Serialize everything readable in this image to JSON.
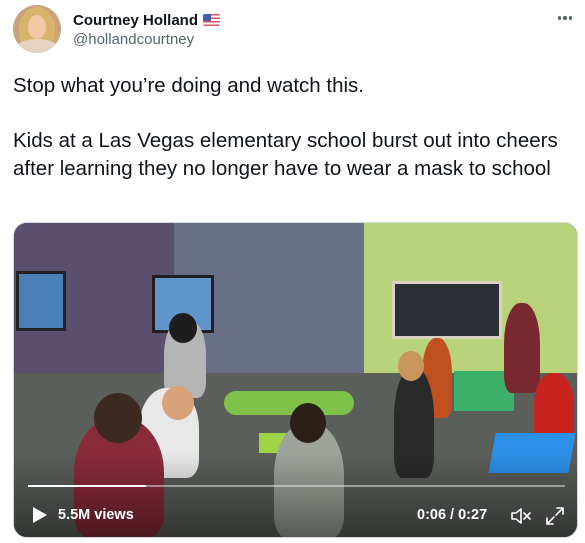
{
  "author": {
    "display_name": "Courtney Holland",
    "handle": "@hollandcourtney",
    "flag_icon": "us-flag-icon"
  },
  "tweet": {
    "line1": "Stop what you’re doing and watch this.",
    "line2": "Kids at a Las Vegas elementary school burst out into cheers after learning they no longer have to wear a mask to school"
  },
  "video": {
    "views": "5.5M views",
    "time": "0:06 / 0:27",
    "progress_fraction": 0.22,
    "icons": [
      "play-icon",
      "volume-muted-icon",
      "fullscreen-icon"
    ]
  },
  "colors": {
    "text_primary": "#0f1419",
    "text_secondary": "#536471"
  }
}
